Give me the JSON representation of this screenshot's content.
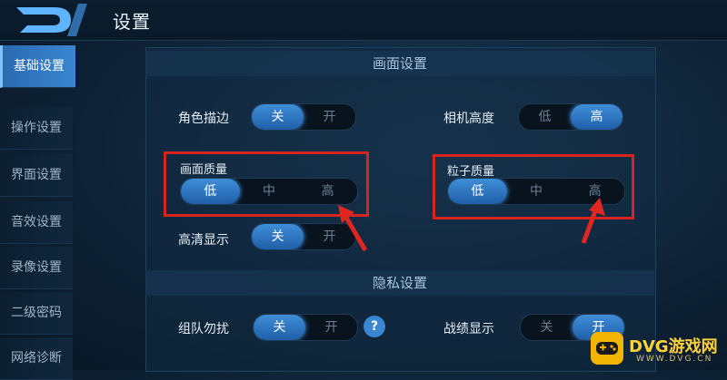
{
  "header": {
    "title": "设置"
  },
  "sidebar": {
    "items": [
      {
        "label": "基础设置",
        "active": true
      },
      {
        "label": "操作设置",
        "active": false
      },
      {
        "label": "界面设置",
        "active": false
      },
      {
        "label": "音效设置",
        "active": false
      },
      {
        "label": "录像设置",
        "active": false
      },
      {
        "label": "二级密码",
        "active": false
      },
      {
        "label": "网络诊断",
        "active": false
      }
    ]
  },
  "sections": {
    "display": {
      "title": "画面设置",
      "outline": {
        "label": "角色描边",
        "options": [
          "关",
          "开"
        ],
        "selected": "关"
      },
      "camera": {
        "label": "相机高度",
        "options": [
          "低",
          "高"
        ],
        "selected": "高"
      },
      "quality": {
        "label": "画面质量",
        "options": [
          "低",
          "中",
          "高"
        ],
        "selected": "低"
      },
      "particle": {
        "label": "粒子质量",
        "options": [
          "低",
          "中",
          "高"
        ],
        "selected": "低"
      },
      "hd": {
        "label": "高清显示",
        "options": [
          "关",
          "开"
        ],
        "selected": "关"
      }
    },
    "privacy": {
      "title": "隐私设置",
      "team": {
        "label": "组队勿扰",
        "options": [
          "关",
          "开"
        ],
        "selected": "关"
      },
      "record": {
        "label": "战绩显示",
        "options": [
          "关",
          "开"
        ],
        "selected": "开"
      }
    }
  },
  "help": {
    "glyph": "?"
  },
  "watermark": {
    "text": "DVG游戏网",
    "sub": "WWW.DVG.CN"
  },
  "colors": {
    "accent": "#3f8ed8",
    "highlight": "#d8231f",
    "brand": "#f2b400"
  }
}
